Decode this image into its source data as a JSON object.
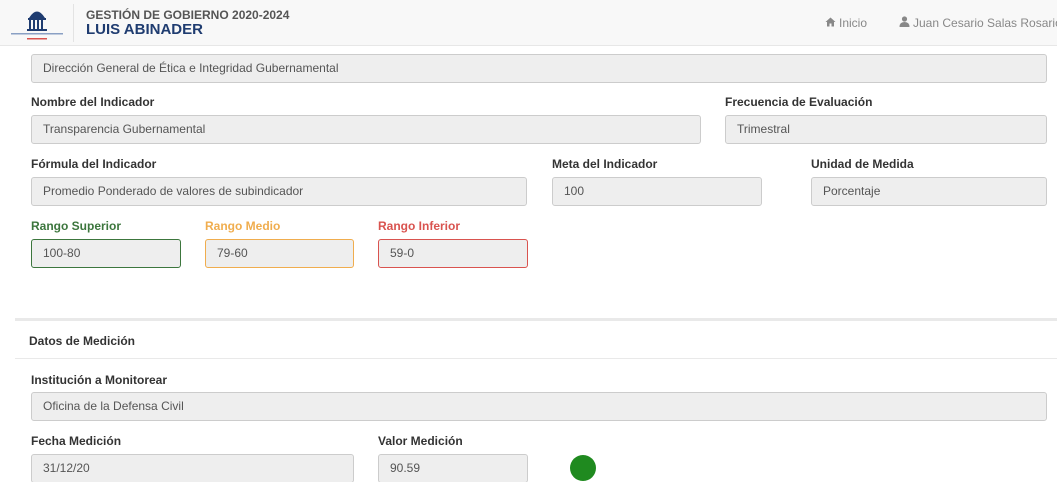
{
  "header": {
    "subtitle": "GESTIÓN DE GOBIERNO 2020-2024",
    "title": "LUIS ABINADER",
    "home_label": "Inicio",
    "user_label": "Juan Cesario Salas Rosario",
    "home_icon": "home-icon",
    "user_icon": "user-icon"
  },
  "form": {
    "institution_value": "Dirección General de Ética e Integridad Gubernamental",
    "indicator_name_label": "Nombre del Indicador",
    "indicator_name_value": "Transparencia Gubernamental",
    "frequency_label": "Frecuencia de Evaluación",
    "frequency_value": "Trimestral",
    "formula_label": "Fórmula del Indicador",
    "formula_value": "Promedio Ponderado de valores de subindicador",
    "goal_label": "Meta del Indicador",
    "goal_value": "100",
    "unit_label": "Unidad de Medida",
    "unit_value": "Porcentaje",
    "range_upper_label": "Rango Superior",
    "range_upper_value": "100-80",
    "range_mid_label": "Rango Medio",
    "range_mid_value": "79-60",
    "range_lower_label": "Rango Inferior",
    "range_lower_value": "59-0"
  },
  "measurement": {
    "section_title": "Datos de Medición",
    "institution_label": "Institución a Monitorear",
    "institution_value": "Oficina de la Defensa Civil",
    "date_label": "Fecha Medición",
    "date_value": "31/12/20",
    "value_label": "Valor Medición",
    "value_value": "90.59",
    "status_color": "#1f8a1f"
  },
  "colors": {
    "brand": "#1f3c70",
    "range_upper": "#3c763d",
    "range_mid": "#f0ad4e",
    "range_lower": "#d9534f"
  }
}
